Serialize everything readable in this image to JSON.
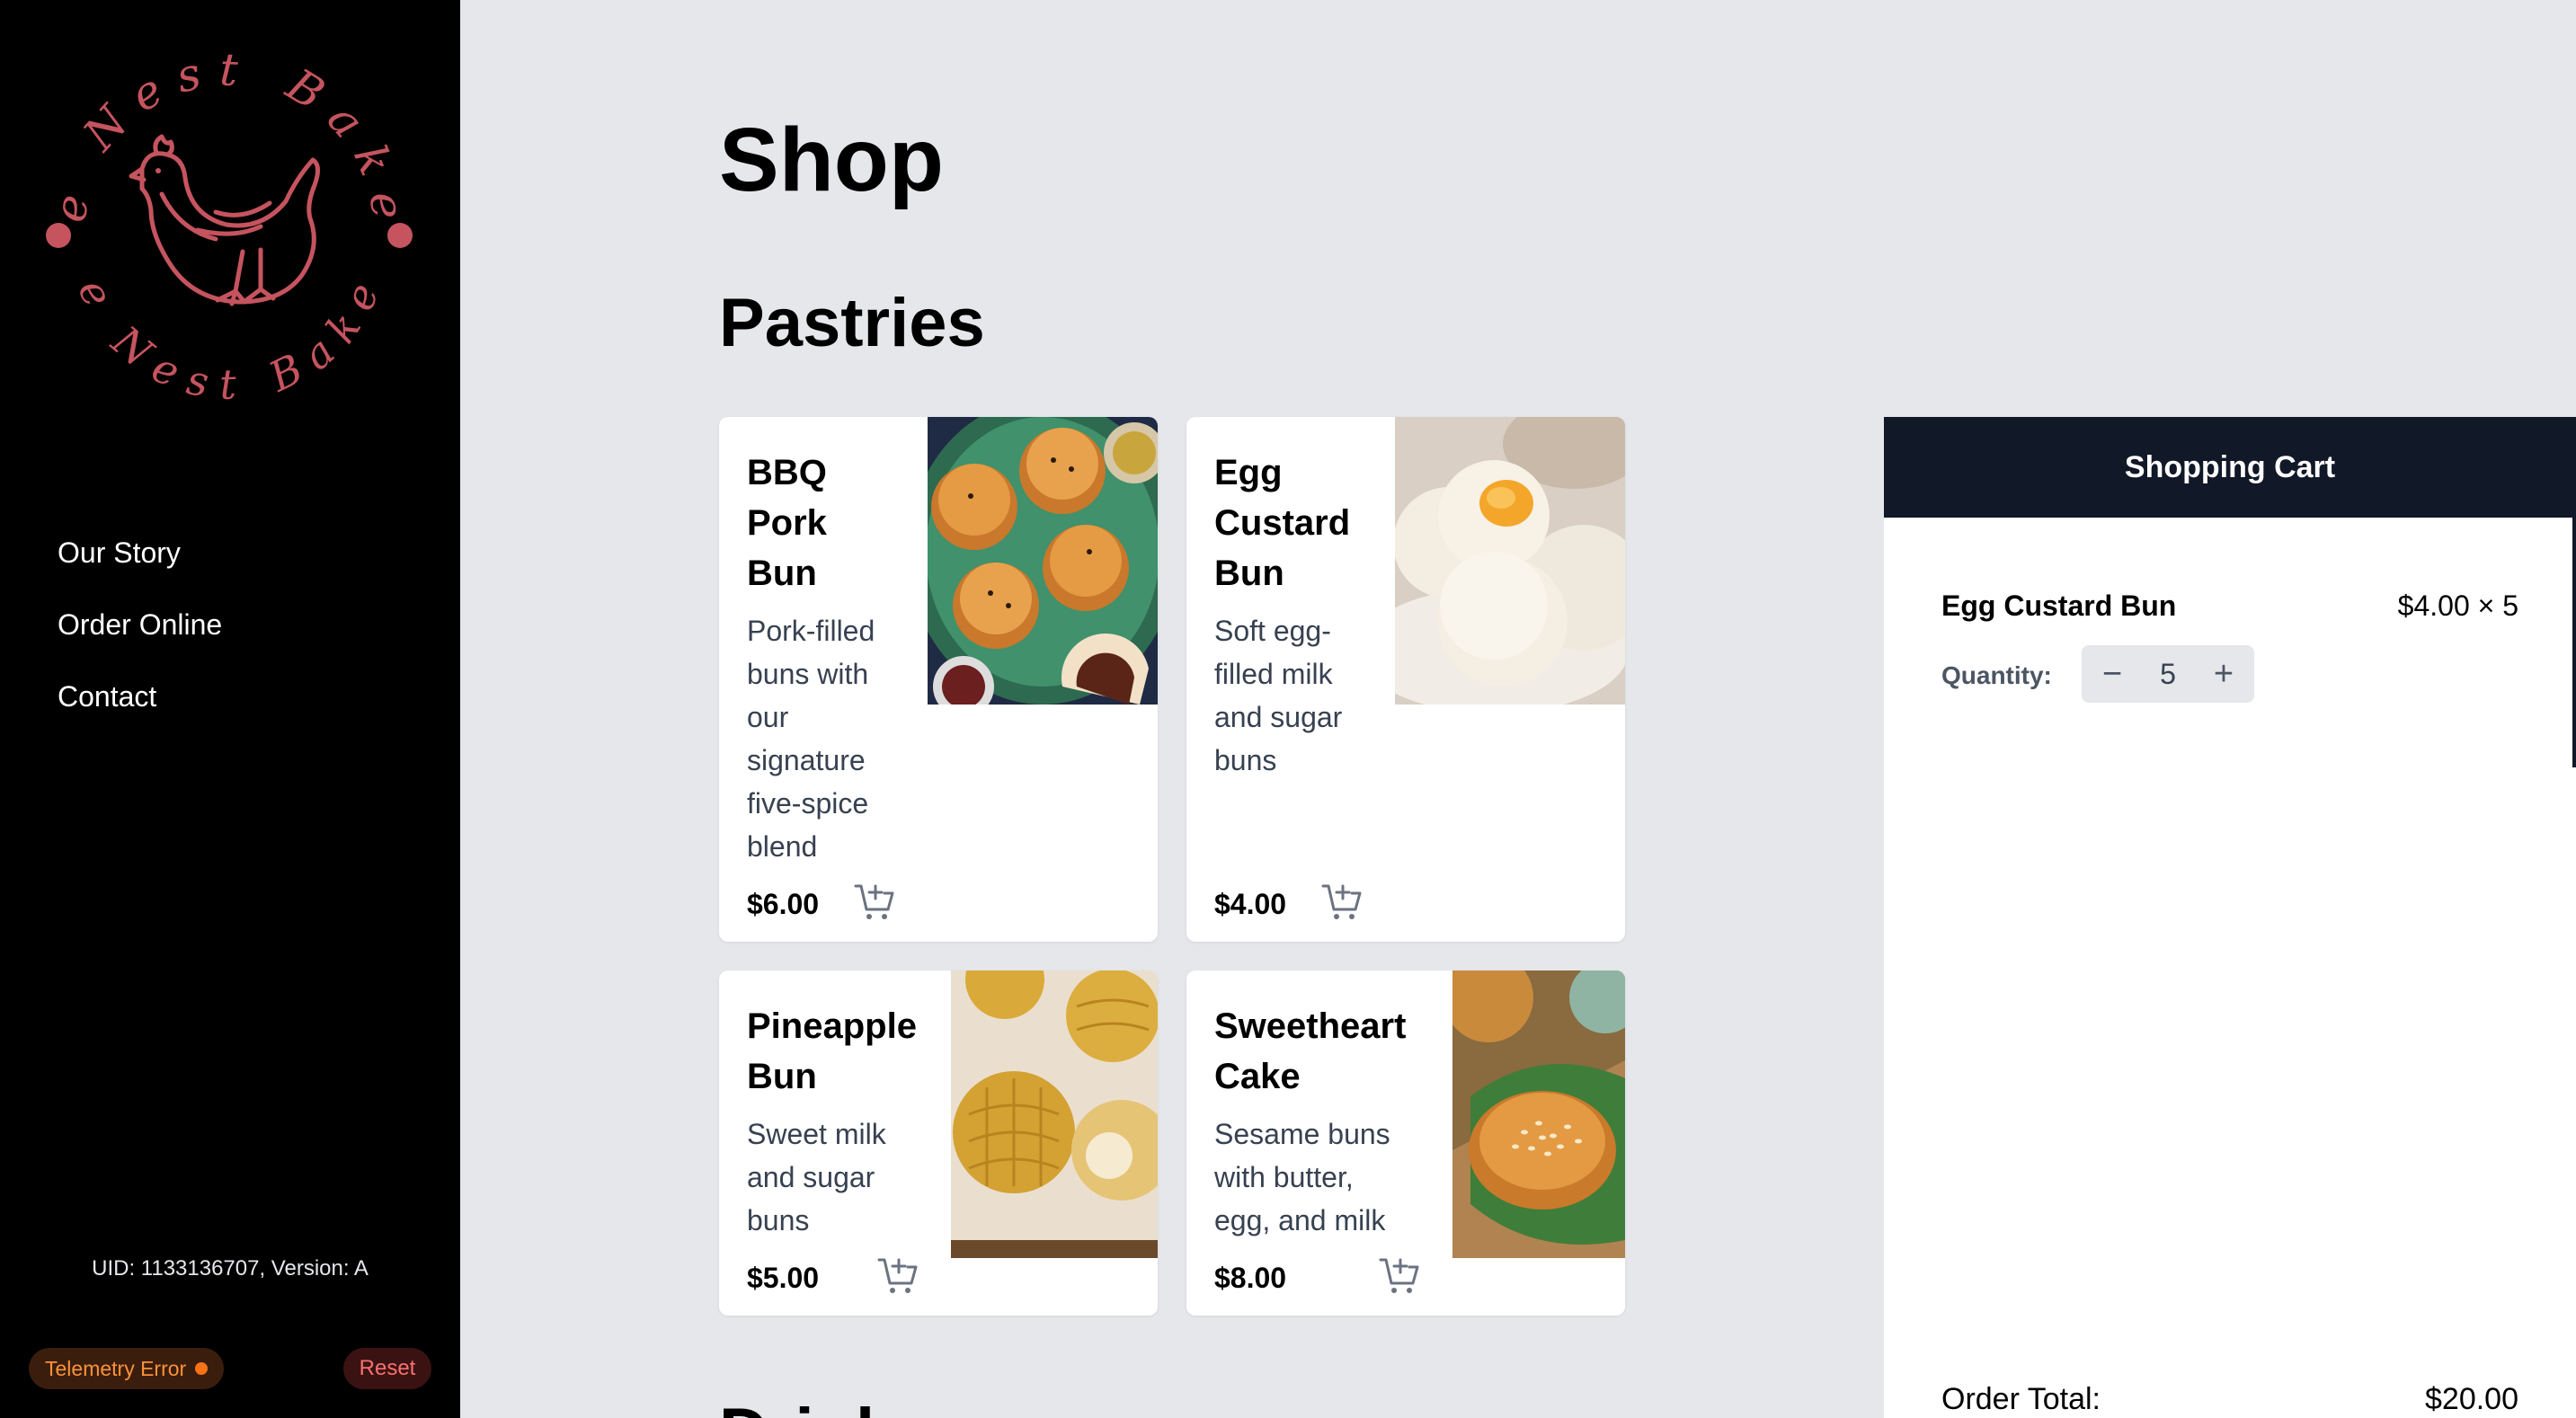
{
  "brand": {
    "name": "The Nest Bakery",
    "accent": "#c5545f"
  },
  "nav": {
    "items": [
      "Our Story",
      "Order Online",
      "Contact"
    ]
  },
  "footer": {
    "uid": "UID: 1133136707, Version: A",
    "telemetry": "Telemetry Error",
    "reset": "Reset"
  },
  "page": {
    "title": "Shop",
    "section": "Pastries",
    "next_section": "Drinks"
  },
  "products": [
    {
      "name_lines": [
        "BBQ",
        "Pork",
        "Bun"
      ],
      "desc_lines": [
        "Pork-filled",
        "buns with",
        "our",
        "signature",
        "five-spice",
        "blend"
      ],
      "price": "$6.00",
      "icon": "add-to-cart-icon"
    },
    {
      "name_lines": [
        "Egg",
        "Custard",
        "Bun"
      ],
      "desc_lines": [
        "Soft egg-",
        "filled milk",
        "and sugar",
        "buns"
      ],
      "price": "$4.00",
      "icon": "add-to-cart-icon"
    },
    {
      "name_lines": [
        "Pineapple",
        "Bun"
      ],
      "desc_lines": [
        "Sweet milk",
        "and sugar",
        "buns"
      ],
      "price": "$5.00",
      "icon": "add-to-cart-icon"
    },
    {
      "name_lines": [
        "Sweetheart",
        "Cake"
      ],
      "desc_lines": [
        "Sesame buns",
        "with butter,",
        "egg, and milk"
      ],
      "price": "$8.00",
      "icon": "add-to-cart-icon"
    }
  ],
  "cart": {
    "title": "Shopping Cart",
    "item": {
      "name": "Egg Custard Bun",
      "price_line": "$4.00 × 5",
      "quantity_label": "Quantity:",
      "quantity": "5"
    },
    "total_label": "Order Total:",
    "total_value": "$20.00"
  }
}
